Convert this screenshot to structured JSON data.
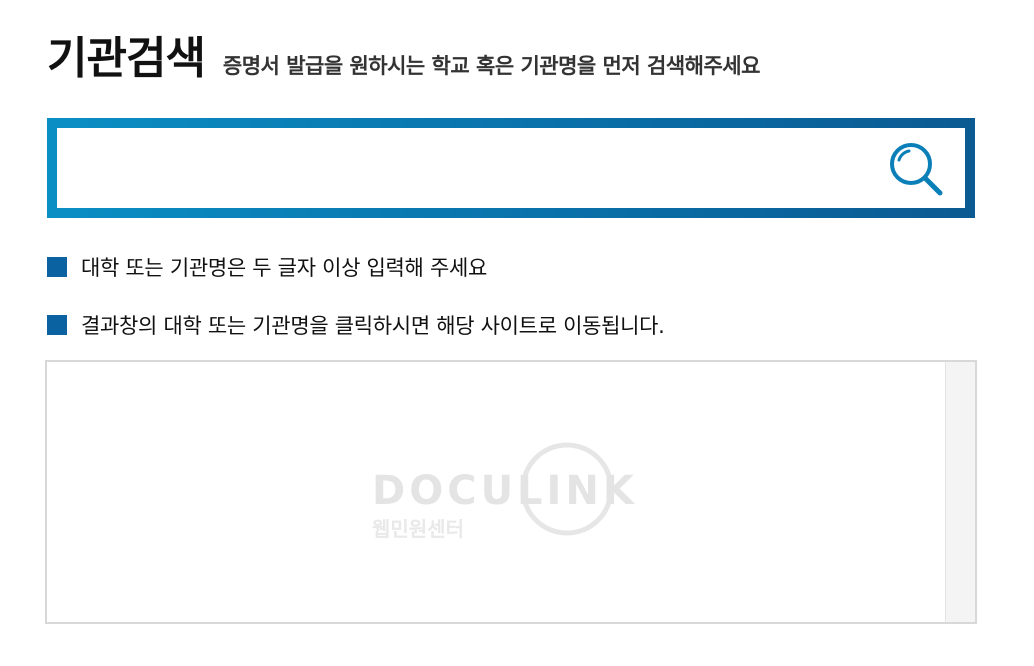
{
  "header": {
    "title": "기관검색",
    "subtitle": "증명서 발급을 원하시는 학교 혹은 기관명을 먼저 검색해주세요"
  },
  "search": {
    "value": "",
    "placeholder": "",
    "border_color_start": "#0a8fc4",
    "border_color_end": "#0b5a92",
    "icon": "search-icon"
  },
  "notes": [
    {
      "text": "대학 또는 기관명은 두 글자 이상 입력해 주세요"
    },
    {
      "text": "결과창의 대학 또는 기관명을 클릭하시면 해당 사이트로 이동됩니다."
    }
  ],
  "results": {
    "watermark": {
      "logo_text": "DOCULINK",
      "sub_text": "웹민원센터"
    }
  },
  "colors": {
    "bullet": "#0a62a0",
    "icon": "#0a7fb8"
  }
}
